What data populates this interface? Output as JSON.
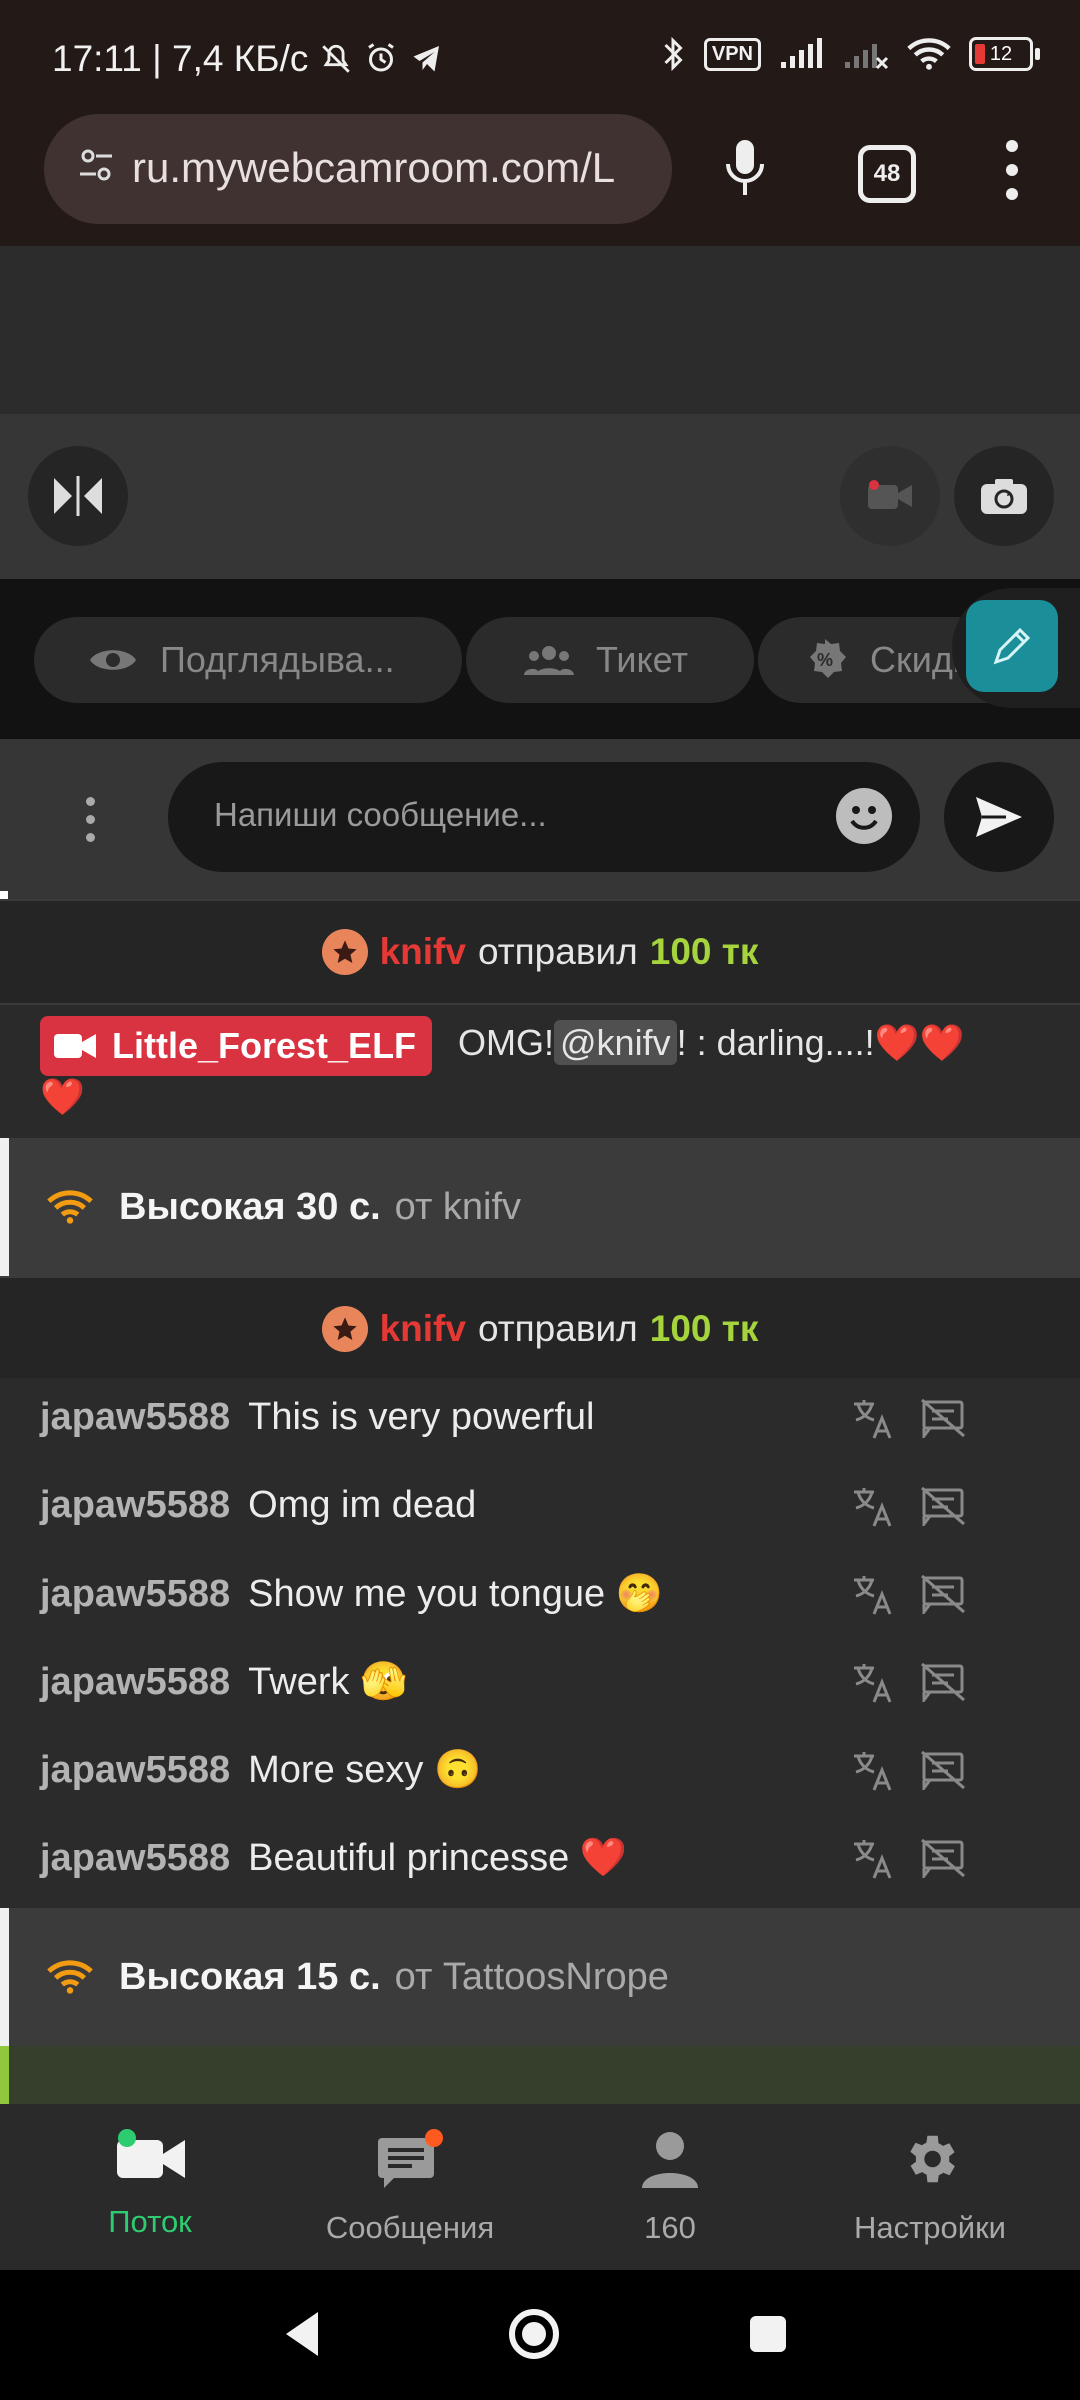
{
  "status_bar": {
    "time_speed": "17:11 | 7,4 КБ/с",
    "vpn": "VPN",
    "battery": "12"
  },
  "browser": {
    "url": "ru.mywebcamroom.com/L",
    "tab_count": "48"
  },
  "chips": [
    {
      "label": "Подглядыва...",
      "icon": "eye-icon"
    },
    {
      "label": "Тикет",
      "icon": "group-icon"
    },
    {
      "label": "Скидка",
      "icon": "discount-icon"
    }
  ],
  "composer": {
    "placeholder": "Напиши сообщение..."
  },
  "tips": [
    {
      "nick": "knifv",
      "action": "отправил",
      "amount": "100 тк"
    },
    {
      "nick": "knifv",
      "action": "отправил",
      "amount": "100 тк"
    }
  ],
  "broadcaster_message": {
    "name": "Little_Forest_ELF",
    "pre": "OMG!",
    "mention": "@knifv",
    "post": "! : darling....!"
  },
  "priority": [
    {
      "level": "Высокая 30 с.",
      "from": "от knifv"
    },
    {
      "level": "Высокая 15 с.",
      "from": "от TattoosNrope"
    }
  ],
  "chat": [
    {
      "user": "japaw5588",
      "text": "This is very powerful"
    },
    {
      "user": "japaw5588",
      "text": "Omg im dead"
    },
    {
      "user": "japaw5588",
      "text": "Show me you tongue 🤭"
    },
    {
      "user": "japaw5588",
      "text": "Twerk 🫣"
    },
    {
      "user": "japaw5588",
      "text": "More sexy 🙃"
    },
    {
      "user": "japaw5588",
      "text": "Beautiful princesse ❤️"
    }
  ],
  "nav": {
    "stream": "Поток",
    "messages": "Сообщения",
    "viewers": "160",
    "settings": "Настройки"
  },
  "colors": {
    "active_green": "#2ecc71",
    "tip_nick_red": "#e53935",
    "tip_amount_green": "#a5d43c",
    "broadcaster_badge": "#d93240"
  }
}
